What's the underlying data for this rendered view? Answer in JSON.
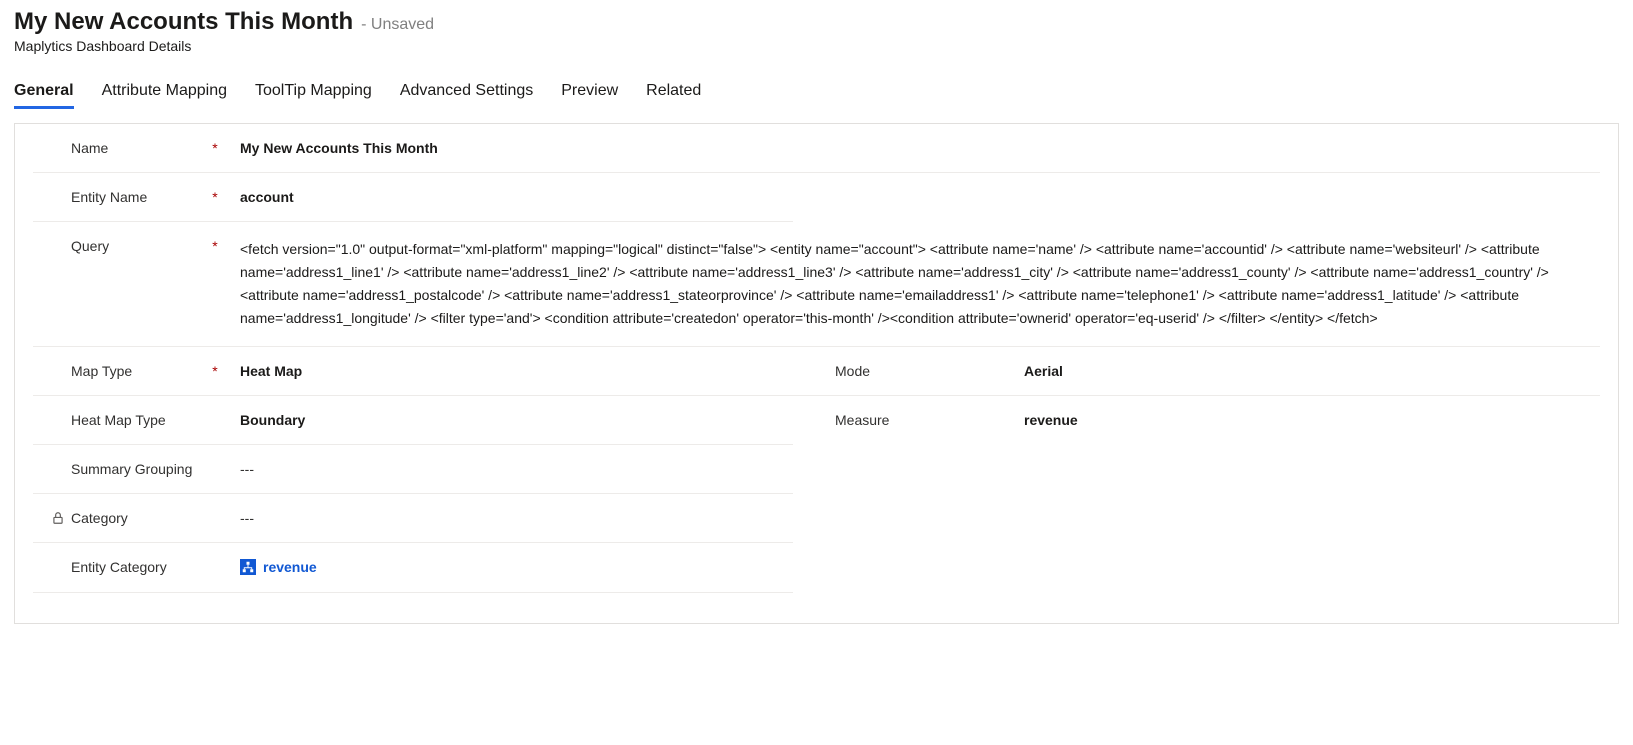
{
  "header": {
    "title": "My New Accounts This Month",
    "unsaved": "- Unsaved",
    "subtitle": "Maplytics Dashboard Details"
  },
  "tabs": {
    "general": "General",
    "attribute_mapping": "Attribute Mapping",
    "tooltip_mapping": "ToolTip Mapping",
    "advanced_settings": "Advanced Settings",
    "preview": "Preview",
    "related": "Related"
  },
  "fields": {
    "name": {
      "label": "Name",
      "value": "My New Accounts This Month"
    },
    "entity_name": {
      "label": "Entity Name",
      "value": "account"
    },
    "query": {
      "label": "Query",
      "value": "<fetch version=\"1.0\" output-format=\"xml-platform\"  mapping=\"logical\" distinct=\"false\">    <entity name=\"account\">  <attribute name='name' />  <attribute name='accountid' />  <attribute name='websiteurl' />  <attribute name='address1_line1' />  <attribute   name='address1_line2' />  <attribute   name='address1_line3' />  <attribute name='address1_city' />  <attribute name='address1_county' />  <attribute name='address1_country' />    <attribute name='address1_postalcode' />  <attribute name='address1_stateorprovince' />  <attribute name='emailaddress1' />  <attribute   name='telephone1' />  <attribute name='address1_latitude' />  <attribute name='address1_longitude' />  <filter  type='and'>  <condition  attribute='createdon' operator='this-month' /><condition attribute='ownerid' operator='eq-userid' />  </filter>  </entity>    </fetch>"
    },
    "map_type": {
      "label": "Map Type",
      "value": "Heat Map"
    },
    "mode": {
      "label": "Mode",
      "value": "Aerial"
    },
    "heat_map_type": {
      "label": "Heat Map Type",
      "value": "Boundary"
    },
    "measure": {
      "label": "Measure",
      "value": "revenue"
    },
    "summary_grouping": {
      "label": "Summary Grouping",
      "value": "---"
    },
    "category": {
      "label": "Category",
      "value": "---"
    },
    "entity_category": {
      "label": "Entity Category",
      "value": "revenue"
    }
  }
}
